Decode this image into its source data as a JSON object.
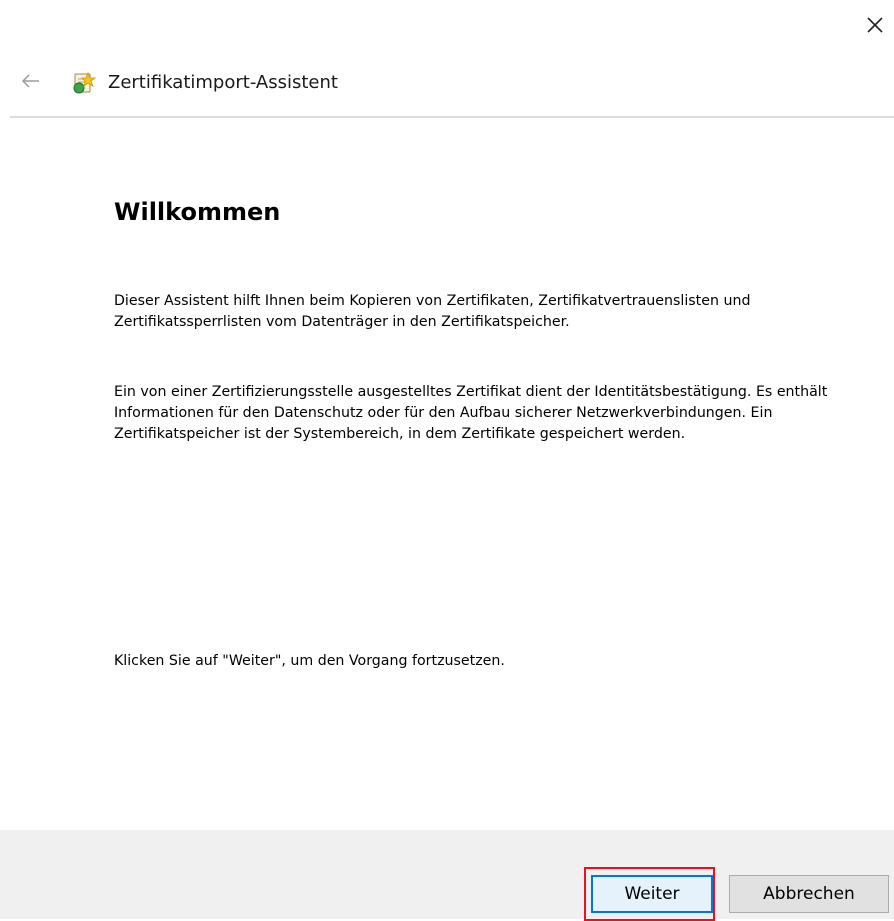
{
  "window": {
    "close_icon": "close-icon"
  },
  "header": {
    "back_icon": "back-arrow-icon",
    "wizard_icon": "certificate-wizard-icon",
    "title": "Zertifikatimport-Assistent"
  },
  "main": {
    "heading": "Willkommen",
    "paragraph_1": "Dieser Assistent hilft Ihnen beim Kopieren von Zertifikaten, Zertifikatvertrauenslisten und Zertifikatssperrlisten vom Datenträger in den Zertifikatspeicher.",
    "paragraph_2": "Ein von einer Zertifizierungsstelle ausgestelltes Zertifikat dient der Identitätsbestätigung. Es enthält Informationen für den Datenschutz oder für den Aufbau sicherer Netzwerkverbindungen. Ein Zertifikatspeicher ist der Systembereich, in dem Zertifikate gespeichert werden.",
    "paragraph_3": "Klicken Sie auf \"Weiter\", um den Vorgang fortzusetzen."
  },
  "footer": {
    "next_label": "Weiter",
    "cancel_label": "Abbrechen"
  },
  "colors": {
    "highlight": "#e81123",
    "focus": "#0078d7",
    "footer_bg": "#f0f0f0"
  }
}
